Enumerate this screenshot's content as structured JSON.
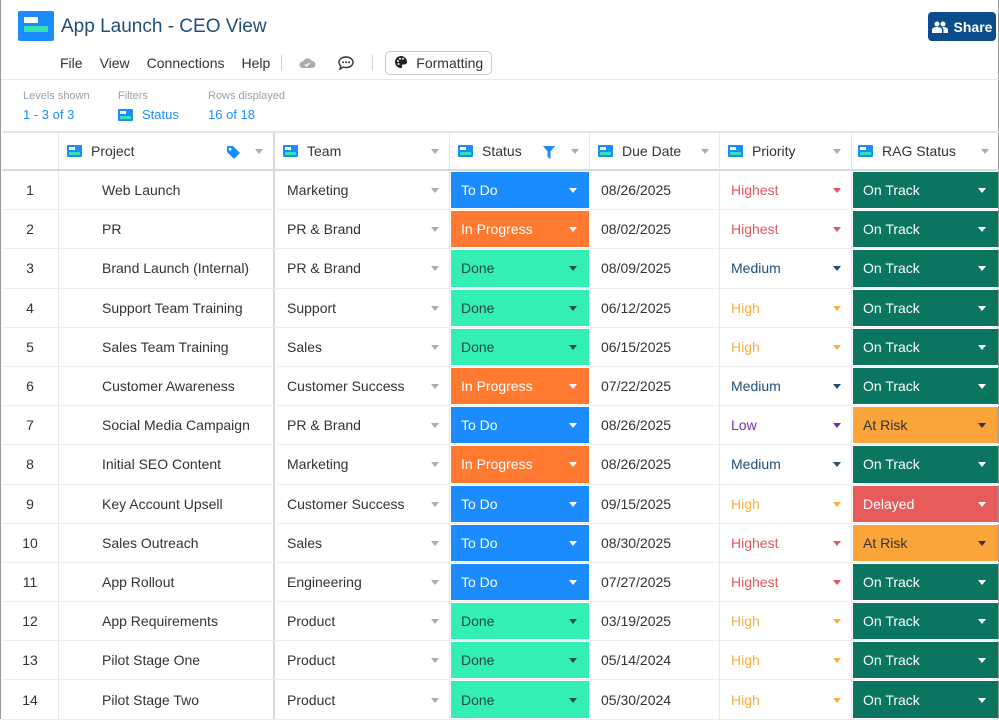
{
  "header": {
    "title": "App Launch - CEO View",
    "menu": [
      "File",
      "View",
      "Connections",
      "Help"
    ],
    "formatting_label": "Formatting",
    "share_label": "Share",
    "icons": {
      "logo": "app-logo",
      "cloud": "cloud-icon",
      "comment": "comment-icon",
      "palette": "palette-icon",
      "share": "people-icon"
    }
  },
  "infobar": {
    "levels": {
      "label": "Levels shown",
      "value": "1 - 3 of 3"
    },
    "filters": {
      "label": "Filters",
      "value": "Status"
    },
    "rows": {
      "label": "Rows displayed",
      "value": "16 of 18"
    }
  },
  "colors": {
    "brand": "#1a8cff",
    "share_bg": "#0b4c8c",
    "status": {
      "To Do": "#1a8cff",
      "In Progress": "#ff7a30",
      "Done": "#34efb4"
    },
    "status_text": {
      "To Do": "#ffffff",
      "In Progress": "#ffffff",
      "Done": "#1f4d3e"
    },
    "priority": {
      "Highest": "#e5565d",
      "High": "#f8ad45",
      "Medium": "#1f4e79",
      "Low": "#7b2aa8"
    },
    "rag": {
      "On Track": "#0a7561",
      "At Risk": "#fba43a",
      "Delayed": "#e85b5b"
    },
    "rag_text": {
      "On Track": "#ffffff",
      "At Risk": "#333333",
      "Delayed": "#ffffff"
    }
  },
  "columns": [
    "Project",
    "Team",
    "Status",
    "Due Date",
    "Priority",
    "RAG Status"
  ],
  "rows": [
    {
      "num": "1",
      "project": "Web Launch",
      "team": "Marketing",
      "status": "To Do",
      "due": "08/26/2025",
      "priority": "Highest",
      "rag": "On Track"
    },
    {
      "num": "2",
      "project": "PR",
      "team": "PR & Brand",
      "status": "In Progress",
      "due": "08/02/2025",
      "priority": "Highest",
      "rag": "On Track"
    },
    {
      "num": "3",
      "project": "Brand Launch (Internal)",
      "team": "PR & Brand",
      "status": "Done",
      "due": "08/09/2025",
      "priority": "Medium",
      "rag": "On Track"
    },
    {
      "num": "4",
      "project": "Support Team Training",
      "team": "Support",
      "status": "Done",
      "due": "06/12/2025",
      "priority": "High",
      "rag": "On Track"
    },
    {
      "num": "5",
      "project": "Sales Team Training",
      "team": "Sales",
      "status": "Done",
      "due": "06/15/2025",
      "priority": "High",
      "rag": "On Track"
    },
    {
      "num": "6",
      "project": "Customer Awareness",
      "team": "Customer Success",
      "status": "In Progress",
      "due": "07/22/2025",
      "priority": "Medium",
      "rag": "On Track"
    },
    {
      "num": "7",
      "project": "Social Media Campaign",
      "team": "PR & Brand",
      "status": "To Do",
      "due": "08/26/2025",
      "priority": "Low",
      "rag": "At Risk"
    },
    {
      "num": "8",
      "project": "Initial SEO Content",
      "team": "Marketing",
      "status": "In Progress",
      "due": "08/26/2025",
      "priority": "Medium",
      "rag": "On Track"
    },
    {
      "num": "9",
      "project": "Key Account Upsell",
      "team": "Customer Success",
      "status": "To Do",
      "due": "09/15/2025",
      "priority": "High",
      "rag": "Delayed"
    },
    {
      "num": "10",
      "project": "Sales Outreach",
      "team": "Sales",
      "status": "To Do",
      "due": "08/30/2025",
      "priority": "Highest",
      "rag": "At Risk"
    },
    {
      "num": "11",
      "project": "App Rollout",
      "team": "Engineering",
      "status": "To Do",
      "due": "07/27/2025",
      "priority": "Highest",
      "rag": "On Track"
    },
    {
      "num": "12",
      "project": "App Requirements",
      "team": "Product",
      "status": "Done",
      "due": "03/19/2025",
      "priority": "High",
      "rag": "On Track"
    },
    {
      "num": "13",
      "project": "Pilot Stage One",
      "team": "Product",
      "status": "Done",
      "due": "05/14/2024",
      "priority": "High",
      "rag": "On Track"
    },
    {
      "num": "14",
      "project": "Pilot Stage Two",
      "team": "Product",
      "status": "Done",
      "due": "05/30/2024",
      "priority": "High",
      "rag": "On Track"
    }
  ]
}
